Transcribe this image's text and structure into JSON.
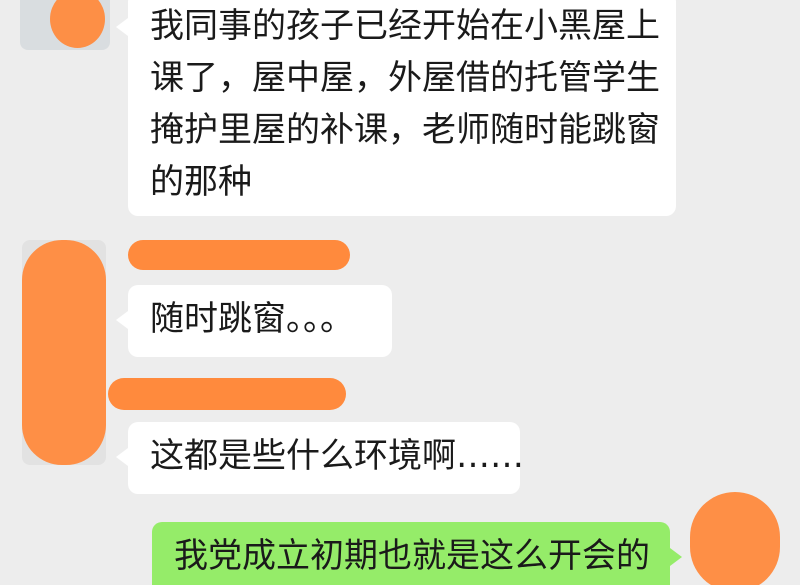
{
  "colors": {
    "background": "#ededed",
    "incoming_bubble": "#ffffff",
    "outgoing_bubble": "#95ec69",
    "redaction": "#ff8a3d"
  },
  "messages": [
    {
      "direction": "incoming",
      "lines": [
        "我同事的孩子已经开始在小黑屋上",
        "课了，屋中屋，外屋借的托管学生",
        "掩护里屋的补课，老师随时能跳窗",
        "的那种"
      ]
    },
    {
      "direction": "incoming",
      "lines": [
        "随时跳窗。。。"
      ]
    },
    {
      "direction": "incoming",
      "lines": [
        "这都是些什么环境啊……"
      ]
    },
    {
      "direction": "outgoing",
      "lines": [
        "我党成立初期也就是这么开会的"
      ]
    }
  ]
}
